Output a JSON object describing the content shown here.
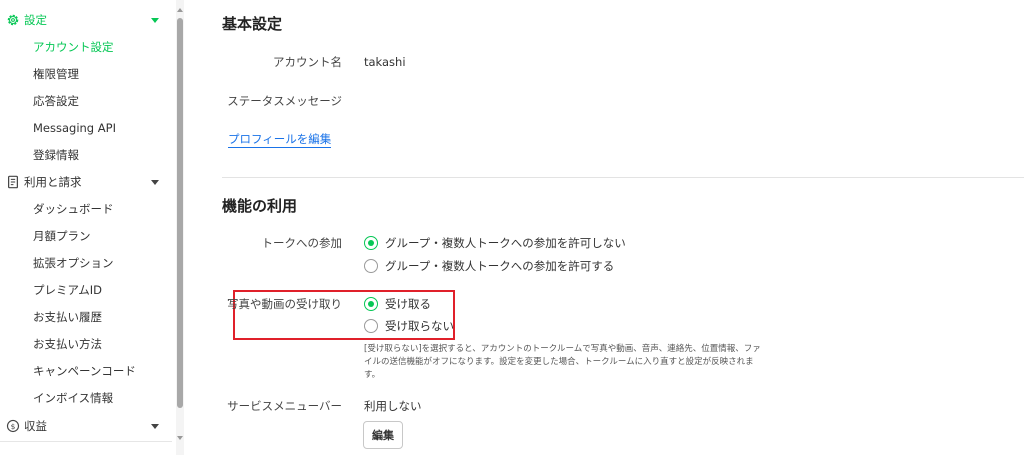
{
  "sidebar": {
    "settings": {
      "label": "設定",
      "items": [
        "アカウント設定",
        "権限管理",
        "応答設定",
        "Messaging API",
        "登録情報"
      ]
    },
    "billing": {
      "label": "利用と請求",
      "items": [
        "ダッシュボード",
        "月額プラン",
        "拡張オプション",
        "プレミアムID",
        "お支払い履歴",
        "お支払い方法",
        "キャンペーンコード",
        "インボイス情報"
      ]
    },
    "revenue": {
      "label": "収益"
    }
  },
  "basic": {
    "title": "基本設定",
    "account_name_label": "アカウント名",
    "account_name_value": "takashi",
    "status_message_label": "ステータスメッセージ",
    "edit_profile_link": "プロフィールを編集"
  },
  "features": {
    "title": "機能の利用",
    "talk_label": "トークへの参加",
    "talk_options": [
      "グループ・複数人トークへの参加を許可しない",
      "グループ・複数人トークへの参加を許可する"
    ],
    "talk_selected": 0,
    "media_label": "写真や動画の受け取り",
    "media_options": [
      "受け取る",
      "受け取らない"
    ],
    "media_selected": 0,
    "media_note": "[受け取らない]を選択すると、アカウントのトークルームで写真や動画、音声、連絡先、位置情報、ファイルの送信機能がオフになります。設定を変更した場合、トークルームに入り直すと設定が反映されます。",
    "service_menu_label": "サービスメニューバー",
    "service_menu_value": "利用しない",
    "edit_button": "編集"
  },
  "colors": {
    "accent": "#06c755",
    "link": "#1a73e8",
    "highlight": "#e0202a"
  }
}
